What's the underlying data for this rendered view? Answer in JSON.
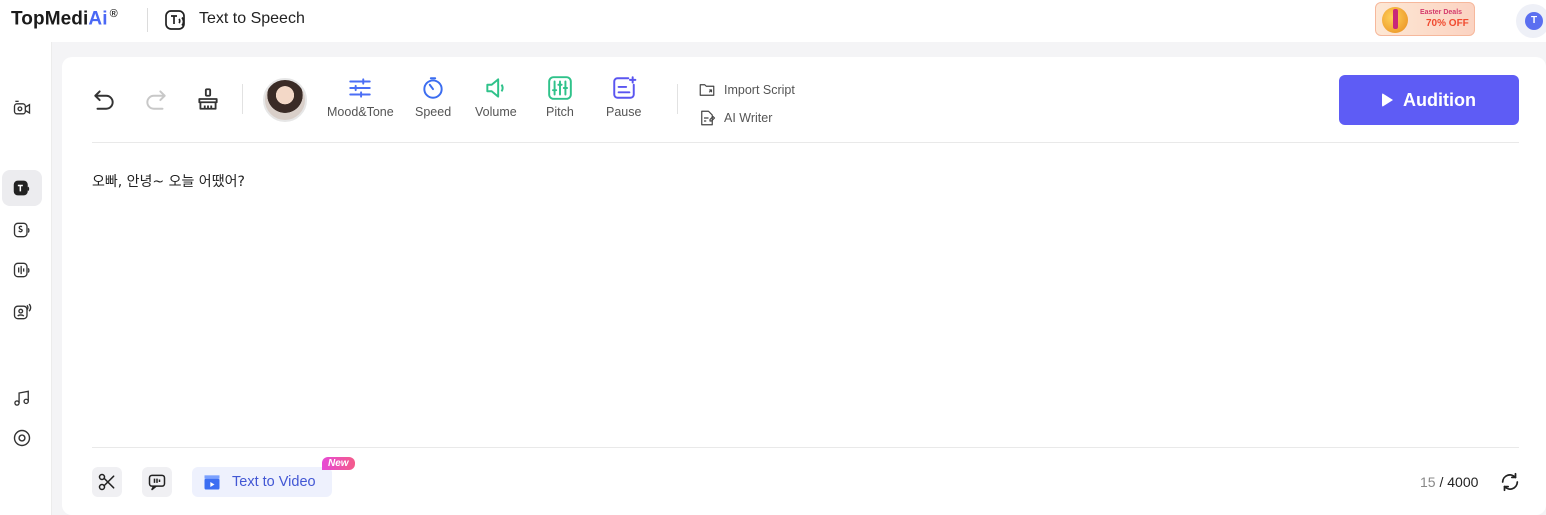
{
  "app": {
    "brand_prefix": "TopMedi",
    "brand_ai": "Ai",
    "brand_reg": "®",
    "page_title": "Text to Speech"
  },
  "promo": {
    "small_text": "Easter Deals",
    "big_text": "70% OFF"
  },
  "account": {
    "avatar_letter": "T"
  },
  "rail": {
    "items": [
      {
        "icon": "video-camera-icon",
        "active": false
      },
      {
        "icon": "text-to-speech-icon",
        "active": true
      },
      {
        "icon": "voice-changer-icon",
        "active": false
      },
      {
        "icon": "voice-cloning-icon",
        "active": false
      },
      {
        "icon": "speech-to-text-icon",
        "active": false
      },
      {
        "icon": "music-note-icon",
        "active": false
      },
      {
        "icon": "vinyl-disc-icon",
        "active": false
      }
    ]
  },
  "toolbar": {
    "undo_icon": "undo-icon",
    "redo_icon": "redo-icon",
    "clear_icon": "broom-icon",
    "tools": [
      {
        "label": "Mood&Tone",
        "icon": "sliders-icon",
        "color": "#4b6ef5"
      },
      {
        "label": "Speed",
        "icon": "speedometer-icon",
        "color": "#3b6df0"
      },
      {
        "label": "Volume",
        "icon": "speaker-icon",
        "color": "#2fc28a"
      },
      {
        "label": "Pitch",
        "icon": "equalizer-icon",
        "color": "#2fc28a"
      },
      {
        "label": "Pause",
        "icon": "pause-note-icon",
        "color": "#5a55f0"
      }
    ],
    "import_script": "Import Script",
    "ai_writer": "AI Writer",
    "audition": "Audition"
  },
  "editor": {
    "text": "오빠, 안녕~ 오늘 어땠어?"
  },
  "footer": {
    "text_to_video": "Text to Video",
    "new_badge": "New",
    "count_current": "15",
    "count_separator": " / ",
    "count_max": "4000"
  },
  "colors": {
    "accent": "#5e5cf5",
    "brand_ai": "#4a68f5"
  }
}
